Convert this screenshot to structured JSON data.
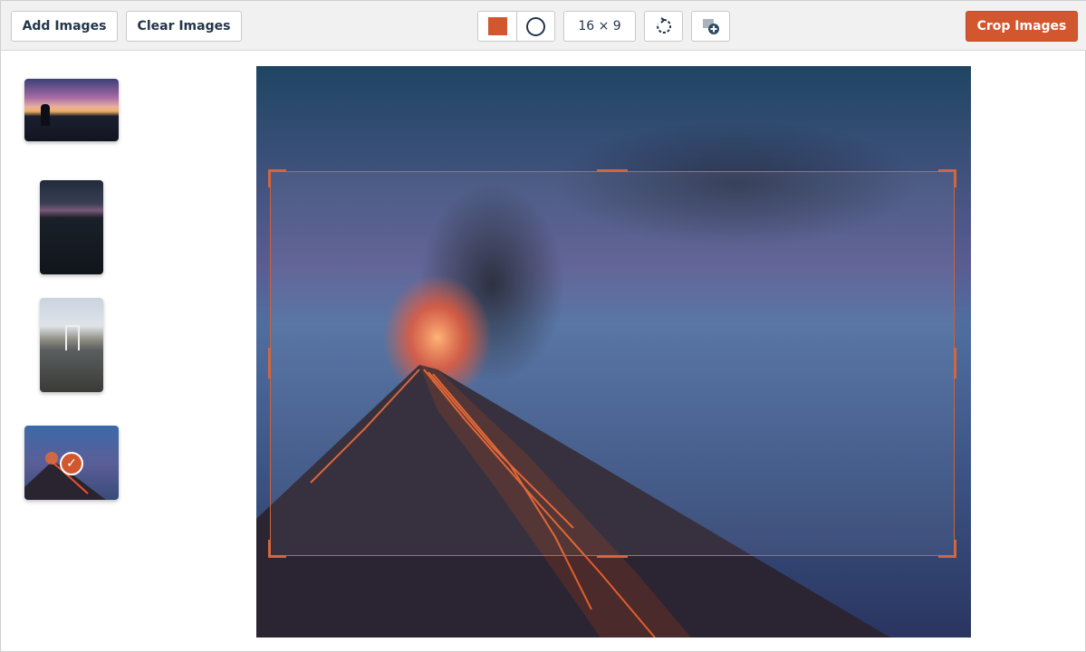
{
  "toolbar": {
    "add_label": "Add Images",
    "clear_label": "Clear Images",
    "aspect_label": "16 × 9",
    "crop_label": "Crop Images",
    "icons": [
      "square-shape-icon",
      "circle-shape-icon",
      "rotate-icon",
      "add-image-icon"
    ]
  },
  "thumbnails": [
    {
      "name": "couple-sunset",
      "selected": false
    },
    {
      "name": "dusk-field",
      "selected": false
    },
    {
      "name": "bridge",
      "selected": false
    },
    {
      "name": "volcano",
      "selected": true
    }
  ],
  "colors": {
    "accent": "#d2572f",
    "text": "#23354a"
  }
}
